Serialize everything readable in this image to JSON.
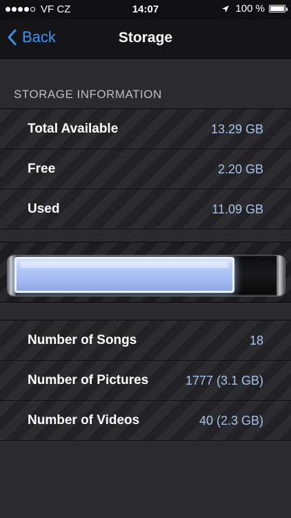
{
  "status_bar": {
    "carrier": "VF CZ",
    "time": "14:07",
    "battery_percent": "100 %",
    "signal_bars_filled": 4,
    "signal_bars_total": 5
  },
  "nav": {
    "back_label": "Back",
    "title": "Storage"
  },
  "storage_information": {
    "header": "STORAGE INFORMATION",
    "rows": [
      {
        "label": "Total Available",
        "value": "13.29 GB"
      },
      {
        "label": "Free",
        "value": "2.20 GB"
      },
      {
        "label": "Used",
        "value": "11.09 GB"
      }
    ]
  },
  "usage_bar": {
    "used_fraction": 0.834
  },
  "media": {
    "rows": [
      {
        "label": "Number of Songs",
        "value": "18"
      },
      {
        "label": "Number of Pictures",
        "value": "1777 (3.1 GB)"
      },
      {
        "label": "Number of Videos",
        "value": "40 (2.3 GB)"
      }
    ]
  },
  "colors": {
    "accent": "#3a94ef",
    "value_text": "#a9c2ec",
    "bar_fill": "#a6bef2"
  }
}
